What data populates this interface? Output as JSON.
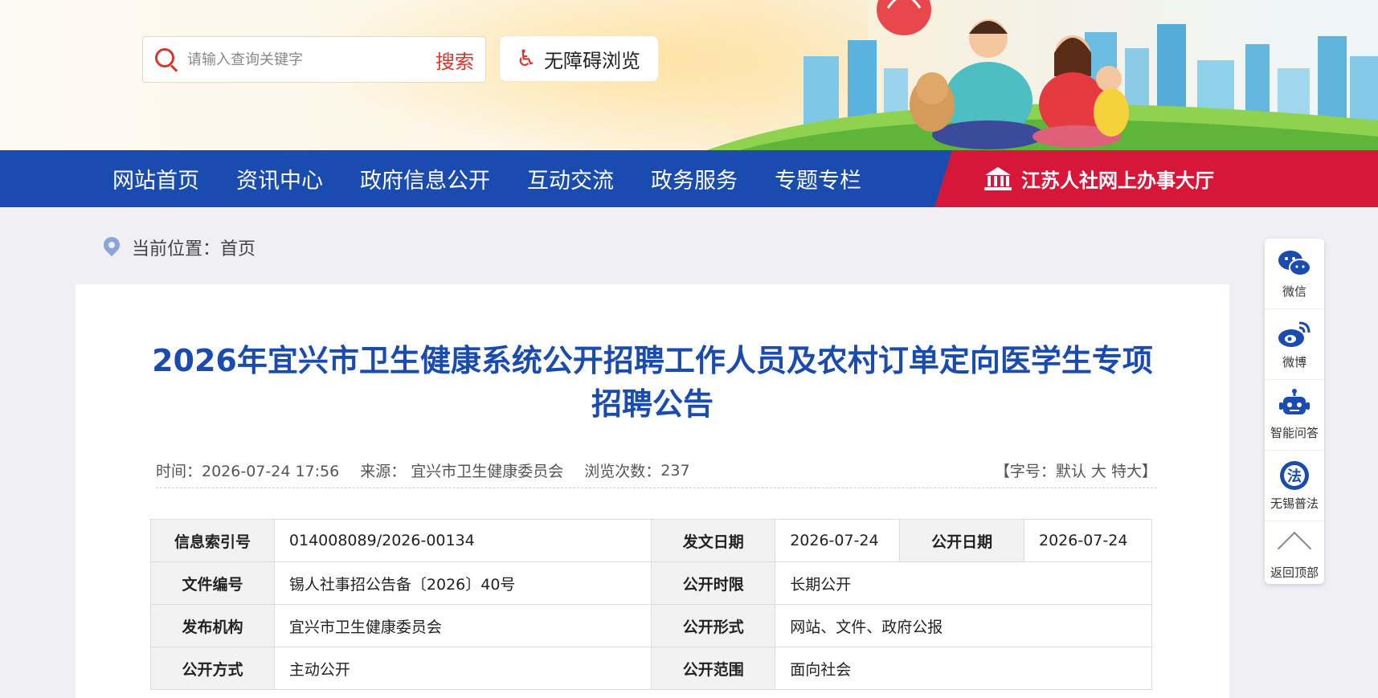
{
  "header": {
    "search": {
      "placeholder": "请输入查询关键字",
      "button_label": "搜索"
    },
    "accessibility_label": "无障碍浏览"
  },
  "nav": {
    "items": [
      "网站首页",
      "资讯中心",
      "政府信息公开",
      "互动交流",
      "政务服务",
      "专题专栏"
    ],
    "hall_label": "江苏人社网上办事大厅"
  },
  "breadcrumb": {
    "text": "当前位置：首页"
  },
  "article": {
    "title": "2026年宜兴市卫生健康系统公开招聘工作人员及农村订单定向医学生专项招聘公告",
    "meta": {
      "time": "时间：2026-07-24 17:56",
      "source": "来源：  宜兴市卫生健康委员会",
      "views_label": "浏览次数：",
      "views": "237",
      "fontsize_prefix": "【字号：",
      "fontsize_default": "默认",
      "fontsize_large": "大",
      "fontsize_xlarge": "特大",
      "fontsize_suffix": "】"
    },
    "info": {
      "row1": {
        "k1": "信息索引号",
        "v1": "014008089/2026-00134",
        "k2": "发文日期",
        "v2": "2026-07-24",
        "k3": "公开日期",
        "v3": "2026-07-24"
      },
      "row2": {
        "k1": "文件编号",
        "v1": "锡人社事招公告备〔2026〕40号",
        "k2": "公开时限",
        "v2": "长期公开"
      },
      "row3": {
        "k1": "发布机构",
        "v1": "宜兴市卫生健康委员会",
        "k2": "公开形式",
        "v2": "网站、文件、政府公报"
      },
      "row4": {
        "k1": "公开方式",
        "v1": "主动公开",
        "k2": "公开范围",
        "v2": "面向社会"
      }
    }
  },
  "side": {
    "wechat": "微信",
    "weibo": "微博",
    "qa": "智能问答",
    "law": "无锡普法",
    "top": "返回顶部"
  },
  "colors": {
    "primary": "#1a4cb0",
    "accent": "#d6173a",
    "search_red": "#d9362b"
  }
}
